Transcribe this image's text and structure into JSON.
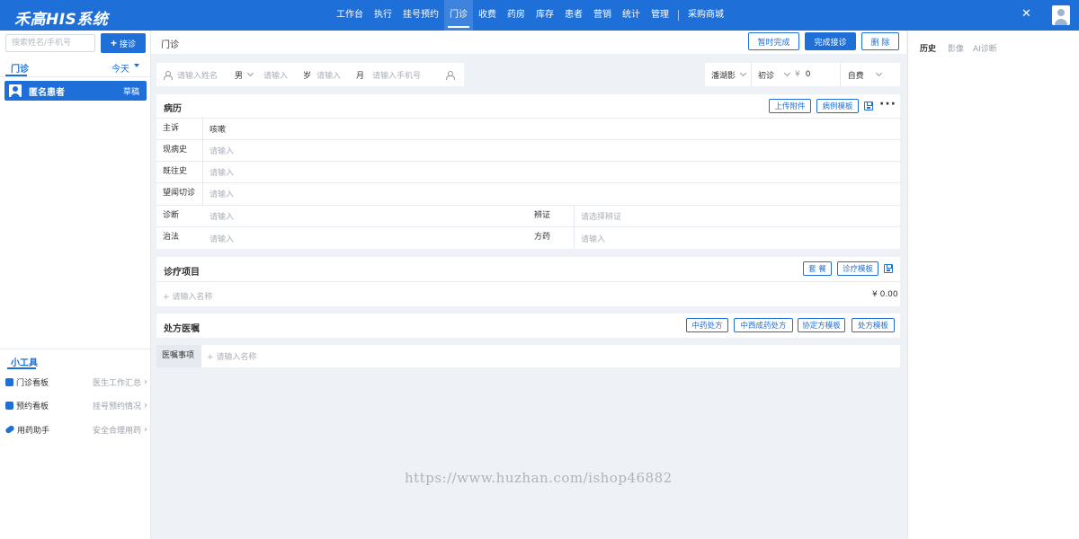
{
  "app": {
    "title": "禾高HIS系统"
  },
  "nav": {
    "items": [
      "工作台",
      "执行",
      "挂号预约",
      "门诊",
      "收费",
      "药房",
      "库存",
      "患者",
      "营销",
      "统计",
      "管理"
    ],
    "active_index": 3,
    "extra": "采购商城"
  },
  "left": {
    "search_placeholder": "搜索姓名/手机号",
    "register_label": "接诊",
    "tab_label": "门诊",
    "date_filter": "今天",
    "patients": [
      {
        "name": "匿名患者",
        "status": "草稿"
      }
    ],
    "tools_title": "小工具",
    "tools": [
      {
        "label": "门诊看板",
        "desc": "医生工作汇总",
        "icon": "dashboard-icon"
      },
      {
        "label": "预约看板",
        "desc": "挂号预约情况",
        "icon": "calendar-icon"
      },
      {
        "label": "用药助手",
        "desc": "安全合理用药",
        "icon": "pill-icon"
      }
    ]
  },
  "header": {
    "title": "门诊",
    "buttons": {
      "close": "暂时完成",
      "finish": "完成接诊",
      "delete": "删 除"
    }
  },
  "patient_info": {
    "name_placeholder": "请输入姓名",
    "gender": "男",
    "age_placeholder": "请输入",
    "age_unit": "岁",
    "month_placeholder": "请输入",
    "month_unit": "月",
    "phone_placeholder": "请输入手机号",
    "visit_category": "潘湖影",
    "visit_type": "初诊",
    "fee_symbol": "¥",
    "fee_value": "0",
    "payment": "自费"
  },
  "record": {
    "title": "病历",
    "buttons": {
      "upload": "上传附件",
      "template": "病例模板"
    },
    "rows": [
      {
        "label": "主诉",
        "value": "咳嗽",
        "filled": true
      },
      {
        "label": "现病史",
        "value": "请输入",
        "filled": false
      },
      {
        "label": "既往史",
        "value": "请输入",
        "filled": false
      },
      {
        "label": "望闻切诊",
        "value": "请输入",
        "filled": false
      }
    ],
    "diagnosis": {
      "label": "诊断",
      "placeholder": "请输入",
      "label2": "辨证",
      "placeholder2": "请选择辨证"
    },
    "treatment": {
      "label": "治法",
      "placeholder": "请输入",
      "label2": "方药",
      "placeholder2": "请输入"
    }
  },
  "treatment_items": {
    "title": "诊疗项目",
    "buttons": {
      "package": "套 餐",
      "template": "诊疗模板"
    },
    "add_placeholder": "+ 请输入名称",
    "total": "¥ 0.00"
  },
  "prescription": {
    "title": "处方医嘱",
    "buttons": {
      "herbal": "中药处方",
      "patent": "中西成药处方",
      "formula": "协定方模板",
      "template": "处方模板"
    }
  },
  "advice": {
    "label": "医嘱事项",
    "placeholder": "+ 请输入名称"
  },
  "right_panel": {
    "tabs": [
      "历史",
      "影像",
      "AI诊断"
    ],
    "active_tab": 0
  },
  "watermark": "https://www.huzhan.com/ishop46882"
}
